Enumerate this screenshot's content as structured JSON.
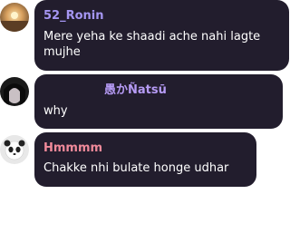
{
  "messages": [
    {
      "username": "52_Ronin",
      "name_color": "#a596f2",
      "avatar_icon": "user-avatar-sunset-icon",
      "lines": [
        "Mere yeha ke shaadi ache nahi lagte",
        "mujhe"
      ]
    },
    {
      "username": "愚かÑatsū",
      "name_color": "#b69bf5",
      "avatar_icon": "user-avatar-dark-hair-icon",
      "lines": [
        "why"
      ]
    },
    {
      "username": "Hmmmm",
      "name_color": "#f08a9a",
      "avatar_icon": "user-avatar-panda-icon",
      "lines": [
        "Chakke nhi bulate honge udhar"
      ]
    }
  ]
}
